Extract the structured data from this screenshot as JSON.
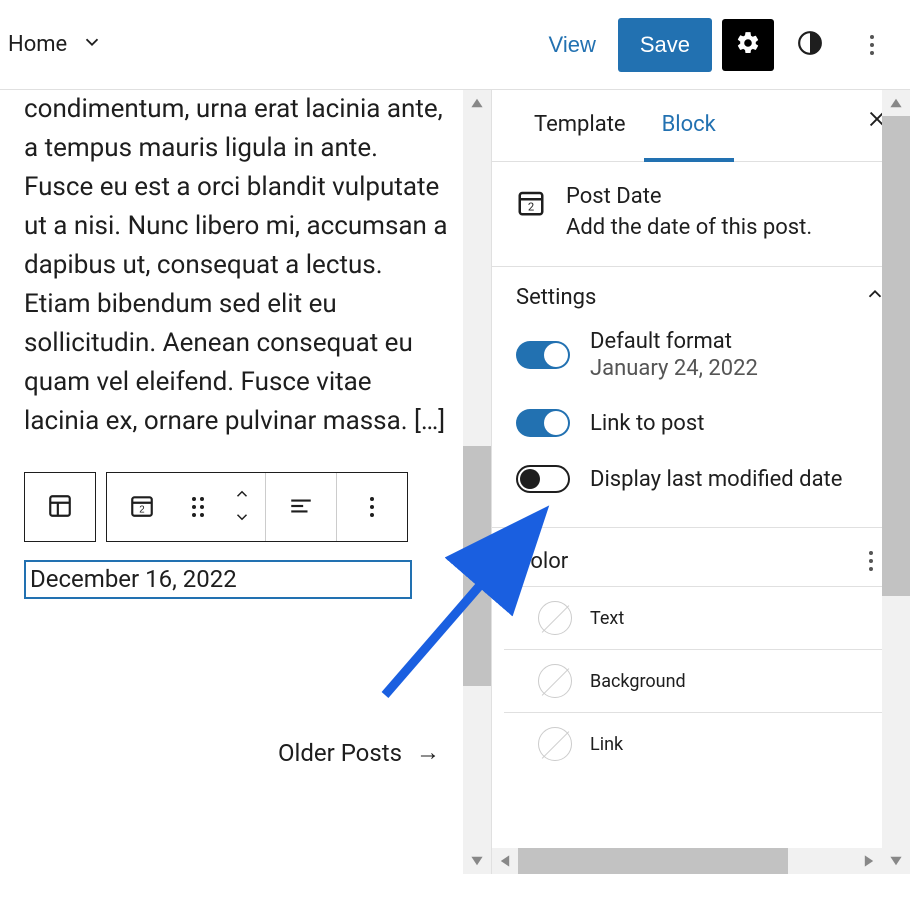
{
  "topbar": {
    "home": "Home",
    "view": "View",
    "save": "Save"
  },
  "editor": {
    "body_text": "condimentum, urna erat lacinia ante, a tempus mauris ligula in ante. Fusce eu est a orci blandit vulputate ut a nisi. Nunc libero mi, accumsan a dapibus ut, consequat a lectus. Etiam bibendum sed elit eu sollicitudin. Aenean consequat eu quam vel eleifend. Fusce vitae lacinia ex, ornare pulvinar massa. […]",
    "date_value": "December 16, 2022",
    "older_posts": "Older Posts"
  },
  "sidebar": {
    "tabs": {
      "template": "Template",
      "block": "Block"
    },
    "block_header": {
      "title": "Post Date",
      "description": "Add the date of this post."
    },
    "settings": {
      "title": "Settings",
      "default_format": {
        "label": "Default format",
        "sub": "January 24, 2022",
        "on": true
      },
      "link_to_post": {
        "label": "Link to post",
        "on": true
      },
      "display_modified": {
        "label": "Display last modified date",
        "on": false
      }
    },
    "color": {
      "title": "Color",
      "items": {
        "text": "Text",
        "background": "Background",
        "link": "Link"
      }
    }
  }
}
